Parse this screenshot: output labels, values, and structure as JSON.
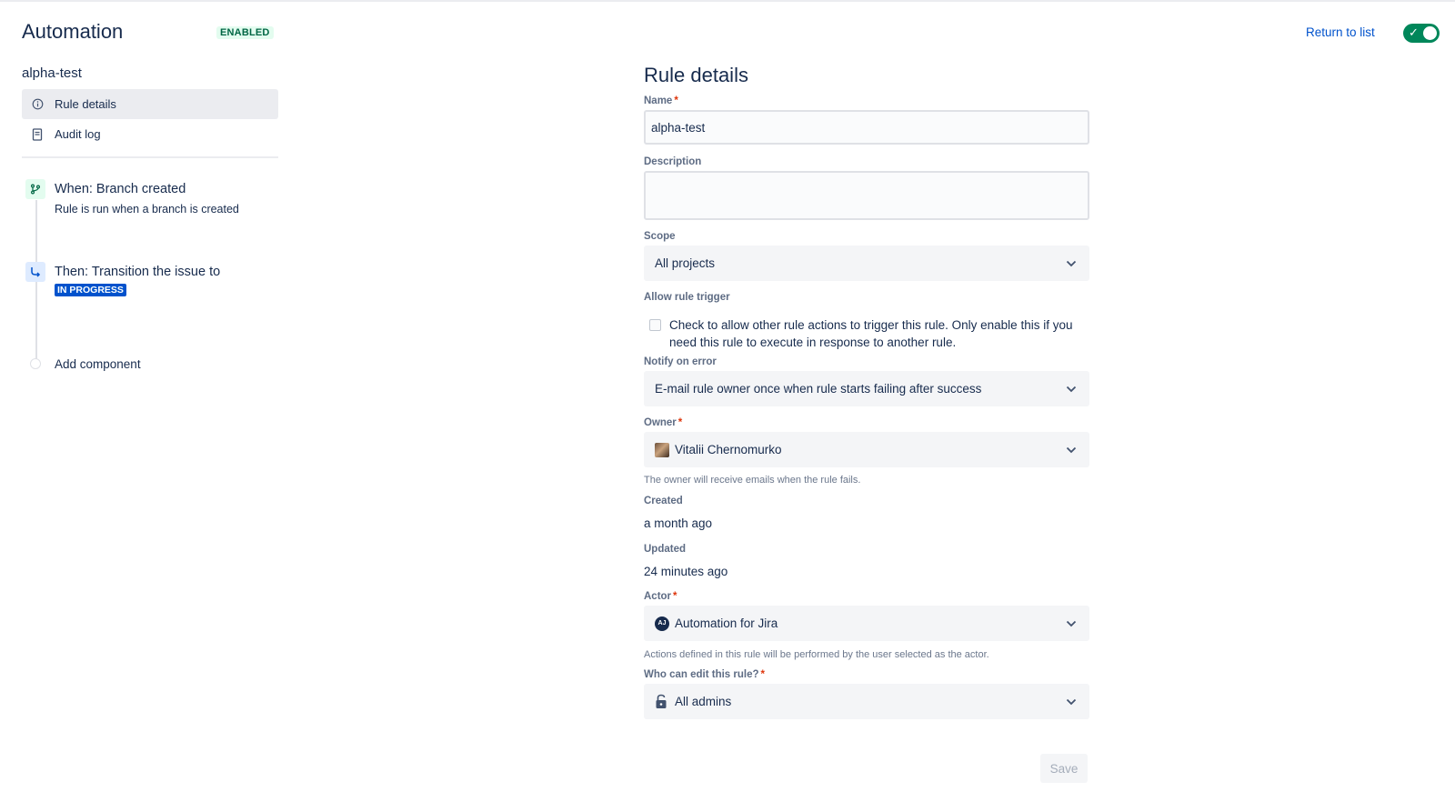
{
  "header": {
    "app_title": "Automation",
    "status": "ENABLED",
    "return_link": "Return to list",
    "toggle_on": true,
    "toggle_color": "#00875a"
  },
  "sidebar": {
    "rule_name": "alpha-test",
    "nav": [
      {
        "label": "Rule details",
        "icon": "info-icon",
        "active": true
      },
      {
        "label": "Audit log",
        "icon": "document-icon",
        "active": false
      }
    ],
    "components": {
      "trigger": {
        "title": "When: Branch created",
        "subtitle": "Rule is run when a branch is created",
        "icon": "branch-icon"
      },
      "action": {
        "title": "Then: Transition the issue to",
        "status": "IN PROGRESS",
        "icon": "transition-icon"
      },
      "add_label": "Add component"
    }
  },
  "form": {
    "title": "Rule details",
    "name": {
      "label": "Name",
      "value": "alpha-test"
    },
    "description": {
      "label": "Description",
      "value": ""
    },
    "scope": {
      "label": "Scope",
      "value": "All projects"
    },
    "allow_trigger": {
      "label": "Allow rule trigger",
      "text": "Check to allow other rule actions to trigger this rule. Only enable this if you need this rule to execute in response to another rule.",
      "checked": false
    },
    "notify": {
      "label": "Notify on error",
      "value": "E-mail rule owner once when rule starts failing after success"
    },
    "owner": {
      "label": "Owner",
      "value": "Vitalii Chernomurko",
      "help": "The owner will receive emails when the rule fails."
    },
    "created": {
      "label": "Created",
      "value": "a month ago"
    },
    "updated": {
      "label": "Updated",
      "value": "24 minutes ago"
    },
    "actor": {
      "label": "Actor",
      "value": "Automation for Jira",
      "avatar_initials": "AJ",
      "help": "Actions defined in this rule will be performed by the user selected as the actor."
    },
    "who_can_edit": {
      "label": "Who can edit this rule?",
      "value": "All admins"
    },
    "save_label": "Save"
  },
  "colors": {
    "primary_text": "#172b4d",
    "link": "#0052cc",
    "status_blue": "#0052cc",
    "enabled_green": "#006644",
    "required": "#de350b"
  }
}
